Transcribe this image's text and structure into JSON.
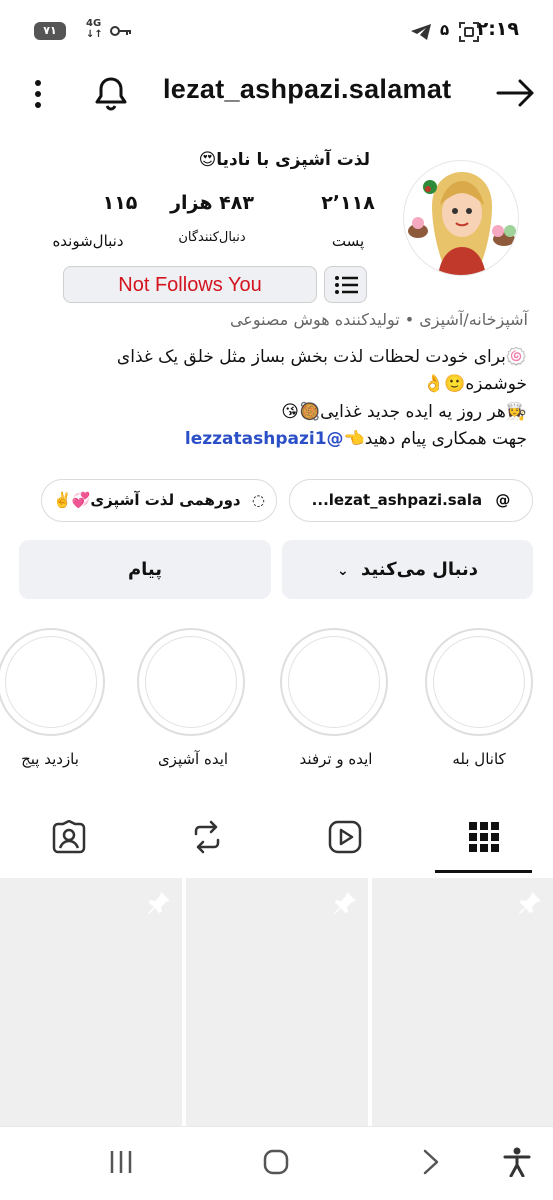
{
  "status_bar": {
    "time": "۲:۱۹",
    "notification_count": "۵",
    "battery": "۷۱",
    "network": "4G"
  },
  "header": {
    "username": "lezat_ashpazi.salamat"
  },
  "profile": {
    "name": "لذت آشپزی با نادیا😍",
    "stats": {
      "posts": {
        "value": "۲٬۱۱۸",
        "label": "پست"
      },
      "followers": {
        "value": "۴۸۳ هزار",
        "label": "دنبال‌کنندگان"
      },
      "following": {
        "value": "۱۱۵",
        "label": "دنبال‌شونده"
      }
    },
    "not_follows_label": "Not Follows You",
    "category": "آشپزخانه/آشپزی • تولیدکننده هوش مصنوعی",
    "bio": {
      "line1": "🍥برای خودت لحظات لذت بخش بساز مثل خلق یک غذای",
      "line2": "خوشمزه🙂👌",
      "line3": "👩‍🍳هر روز یه ایده جدید غذایی🥘😘",
      "line4_text": "جهت همکاری پیام دهید👈",
      "line4_link": "lezzatashpazi1"
    },
    "chips": {
      "threads": "lezat_ashpazi.sala...",
      "channel": "دورهمی لذت آشپزی💞✌️"
    },
    "actions": {
      "follow": "دنبال می‌کنید",
      "message": "پیام"
    }
  },
  "highlights": [
    {
      "label": "کانال بله"
    },
    {
      "label": "ایده و ترفند"
    },
    {
      "label": "ایده آشپزی"
    },
    {
      "label": "بازدید پیج"
    }
  ],
  "tabs": [
    {
      "name": "grid",
      "icon": "grid-icon",
      "active": true
    },
    {
      "name": "reels",
      "icon": "reels-icon",
      "active": false
    },
    {
      "name": "reposts",
      "icon": "repost-icon",
      "active": false
    },
    {
      "name": "tagged",
      "icon": "tagged-icon",
      "active": false
    }
  ],
  "colors": {
    "accent_red": "#d4141f",
    "link_blue": "#2b4fc7",
    "button_bg": "#eff1f5"
  }
}
